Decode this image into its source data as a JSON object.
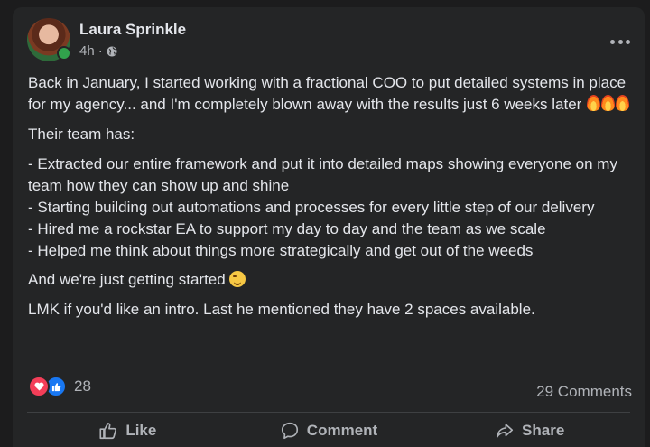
{
  "post": {
    "author": "Laura Sprinkle",
    "time": "4h",
    "separator": "·",
    "paragraphs": [
      "Back in January, I started working with a fractional COO to put detailed systems in place for my agency... and I'm completely blown away with the results just 6 weeks later",
      "Their team has:",
      "- Extracted our entire framework and put it into detailed maps showing everyone on my team how they can show up and shine",
      "- Starting building out automations and processes for every little step of our delivery",
      "- Hired me a rockstar EA to support my day to day and the team as we scale",
      "- Helped me think about things more strategically and get out of the weeds",
      "And we're just getting started",
      "LMK if you'd like an intro. Last he mentioned they have 2 spaces available."
    ]
  },
  "stats": {
    "reaction_count": "28",
    "comments": "29 Comments"
  },
  "actions": {
    "like": "Like",
    "comment": "Comment",
    "share": "Share"
  },
  "icons": {
    "reactions": [
      "love-icon",
      "like-icon"
    ],
    "privacy": "globe-icon",
    "menu": "more-icon"
  },
  "colors": {
    "background": "#242526",
    "text": "#e4e6eb",
    "muted": "#b0b3b8",
    "love": "#f33e58",
    "like": "#1877f2",
    "online": "#31a24c"
  }
}
